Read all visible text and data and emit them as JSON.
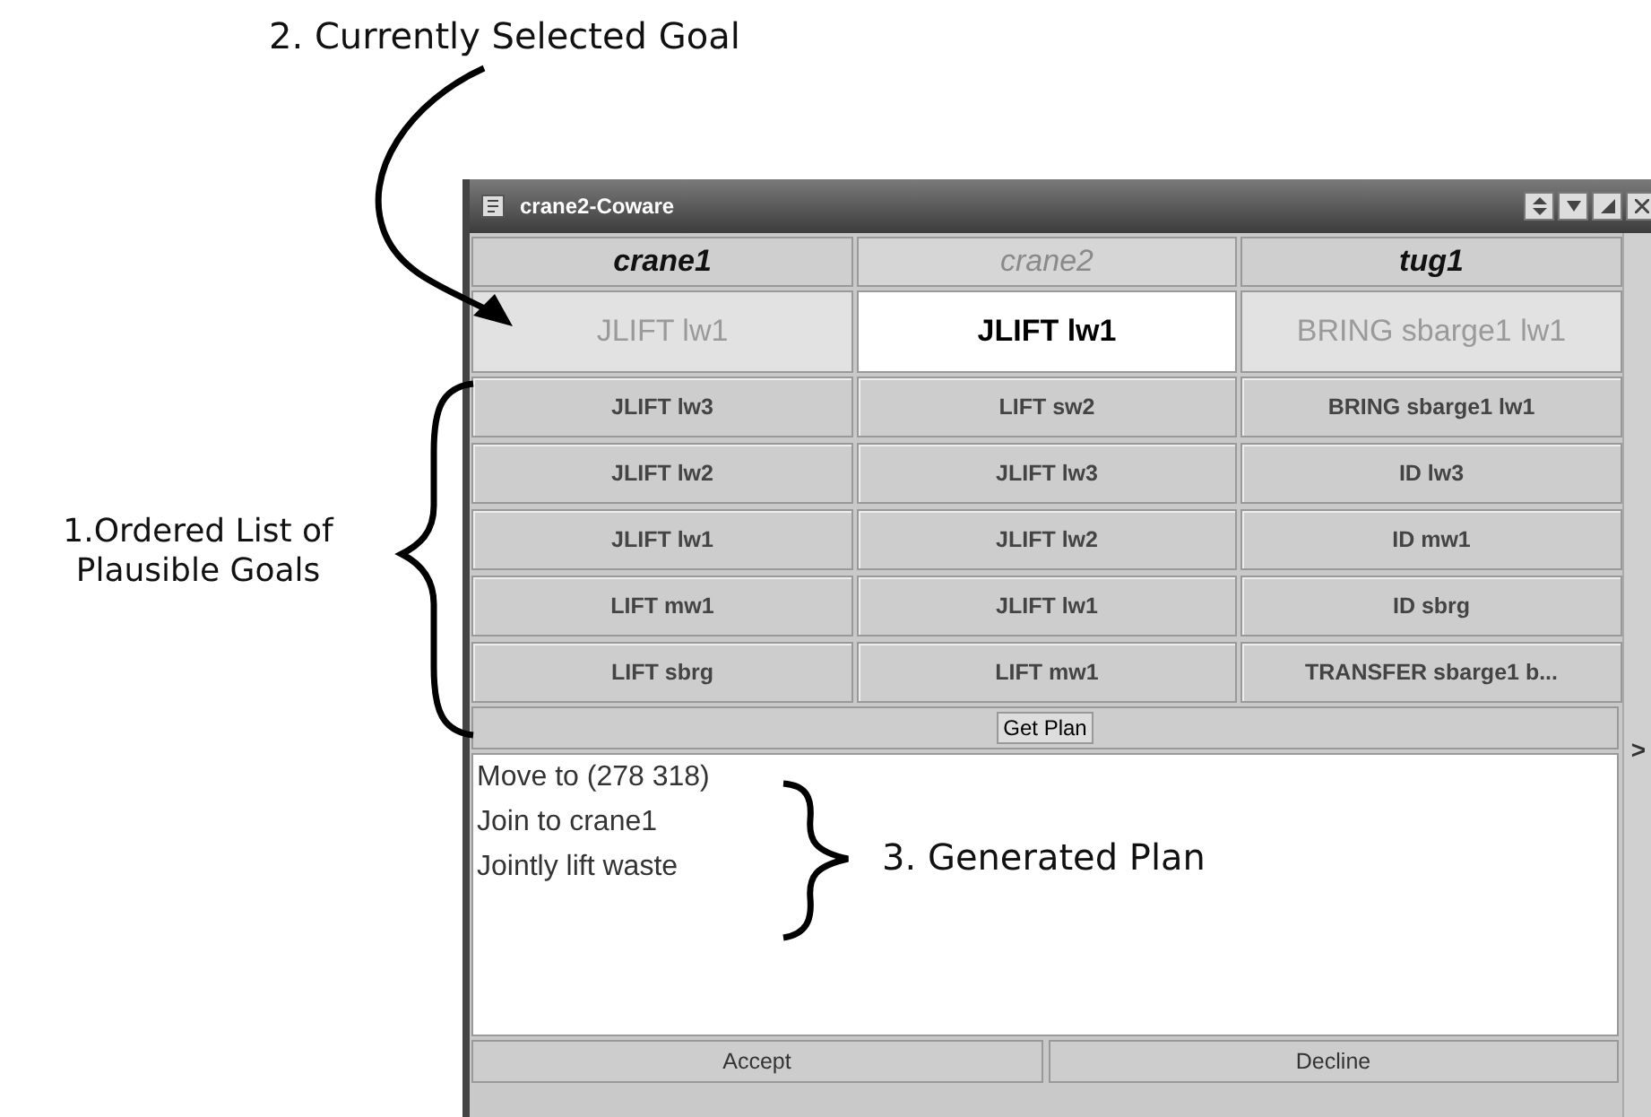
{
  "annotation_selected_goal": "2. Currently Selected Goal",
  "annotation_goal_list": "1.Ordered List of Plausible Goals",
  "annotation_plan": "3. Generated Plan",
  "window": {
    "title": "crane2-Coware"
  },
  "agents": [
    {
      "name": "crane1",
      "self": false
    },
    {
      "name": "crane2",
      "self": true
    },
    {
      "name": "tug1",
      "self": false
    }
  ],
  "current_goals": [
    {
      "label": "JLIFT lw1",
      "selected": false
    },
    {
      "label": "JLIFT lw1",
      "selected": true
    },
    {
      "label": "BRING sbarge1 lw1",
      "selected": false
    }
  ],
  "goal_rows": [
    [
      "JLIFT lw3",
      "LIFT sw2",
      "BRING sbarge1 lw1"
    ],
    [
      "JLIFT lw2",
      "JLIFT lw3",
      "ID lw3"
    ],
    [
      "JLIFT lw1",
      "JLIFT lw2",
      "ID mw1"
    ],
    [
      "LIFT mw1",
      "JLIFT lw1",
      "ID sbrg"
    ],
    [
      "LIFT sbrg",
      "LIFT mw1",
      "TRANSFER sbarge1 b..."
    ]
  ],
  "get_plan_button": "Get Plan",
  "plan_lines": [
    "Move to (278 318)",
    "Join to crane1",
    "Jointly lift waste"
  ],
  "buttons": [
    "Accept",
    "Decline"
  ],
  "side_arrow": ">"
}
